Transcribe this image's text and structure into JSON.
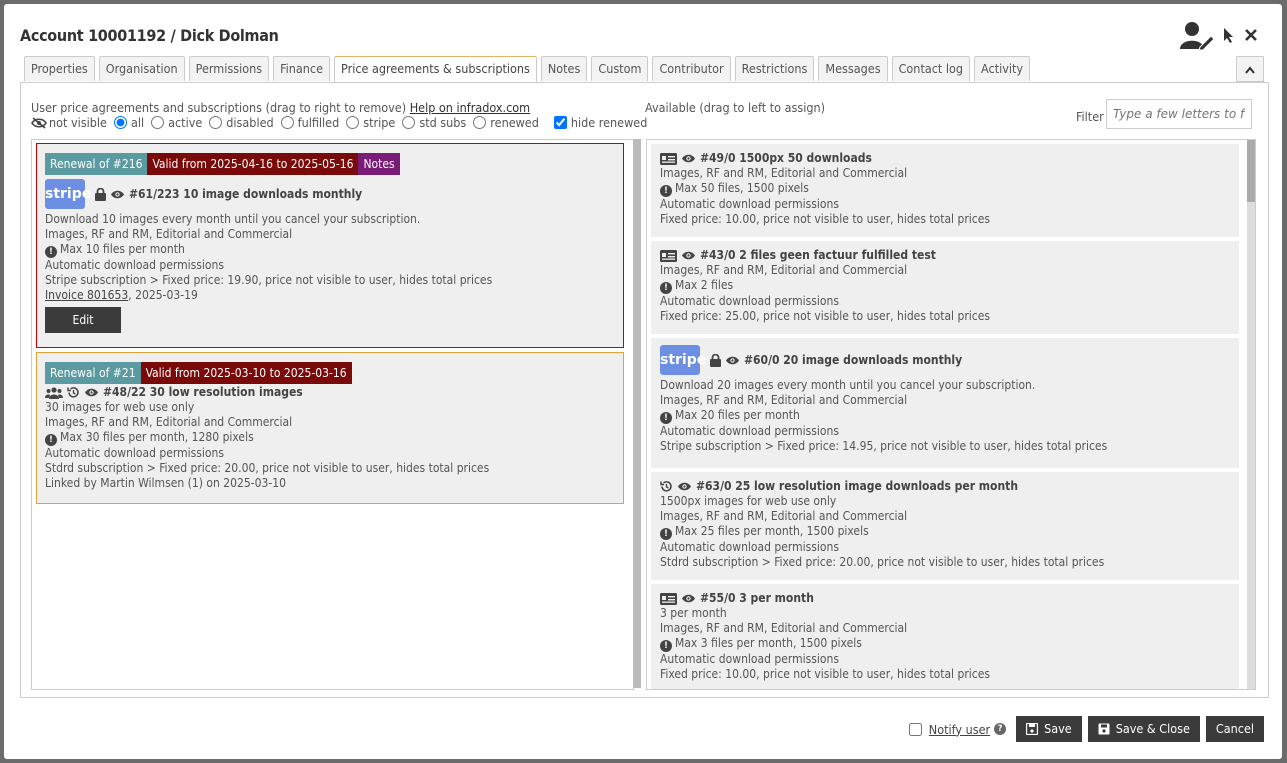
{
  "dialog": {
    "title": "Account 10001192 / Dick Dolman"
  },
  "tabs": [
    {
      "label": "Properties"
    },
    {
      "label": "Organisation"
    },
    {
      "label": "Permissions"
    },
    {
      "label": "Finance"
    },
    {
      "label": "Price agreements & subscriptions",
      "active": true
    },
    {
      "label": "Notes"
    },
    {
      "label": "Custom"
    },
    {
      "label": "Contributor"
    },
    {
      "label": "Restrictions"
    },
    {
      "label": "Messages"
    },
    {
      "label": "Contact log"
    },
    {
      "label": "Activity"
    }
  ],
  "left": {
    "heading": "User price agreements and subscriptions (drag to right to remove)",
    "help_link": "Help on infradox.com",
    "filters": {
      "not_visible": "not visible",
      "all": "all",
      "active": "active",
      "disabled": "disabled",
      "fulfilled": "fulfilled",
      "stripe": "stripe",
      "std_subs": "std subs",
      "renewed": "renewed",
      "hide_renewed": "hide renewed",
      "selected": "all",
      "hide_renewed_checked": true
    },
    "cards": [
      {
        "badges": [
          "Renewal of #216",
          "Valid from 2025-04-16 to 2025-05-16",
          "Notes"
        ],
        "logo": "stripe",
        "title": "#61/223 10 image downloads monthly",
        "lines": [
          "Download 10 images every month until you cancel your subscription.",
          "Images, RF and RM, Editorial and Commercial",
          "Max 10 files per month",
          "Automatic download permissions",
          "Stripe subscription > Fixed price: 19.90, price not visible to user, hides total prices"
        ],
        "invoice_link": "Invoice 801653",
        "invoice_date": ", 2025-03-19",
        "edit_label": "Edit"
      },
      {
        "badges": [
          "Renewal of #21",
          "Valid from 2025-03-10 to 2025-03-16"
        ],
        "title": "#48/22 30 low resolution images",
        "lines": [
          "30 images for web use only",
          "Images, RF and RM, Editorial and Commercial",
          "Max 30 files per month, 1280 pixels",
          "Automatic download permissions",
          "Stdrd subscription > Fixed price: 20.00, price not visible to user, hides total prices",
          "Linked by Martin Wilmsen (1) on 2025-03-10"
        ]
      }
    ]
  },
  "right": {
    "heading": "Available (drag to left to assign)",
    "filter_label": "Filter",
    "filter_placeholder": "Type a few letters to filter",
    "cards": [
      {
        "title": "#49/0 1500px 50 downloads",
        "lines": [
          "Images, RF and RM, Editorial and Commercial",
          "Max 50 files, 1500 pixels",
          "Automatic download permissions",
          "Fixed price: 10.00, price not visible to user, hides total prices"
        ]
      },
      {
        "title": "#43/0 2 files geen factuur fulfilled test",
        "lines": [
          "Images, RF and RM, Editorial and Commercial",
          "Max 2 files",
          "Automatic download permissions",
          "Fixed price: 25.00, price not visible to user, hides total prices"
        ]
      },
      {
        "logo": "stripe",
        "title": "#60/0 20 image downloads monthly",
        "lines": [
          "Download 20 images every month until you cancel your subscription.",
          "Images, RF and RM, Editorial and Commercial",
          "Max 20 files per month",
          "Automatic download permissions",
          "Stripe subscription > Fixed price: 14.95, price not visible to user, hides total prices"
        ]
      },
      {
        "title": "#63/0 25 low resolution image downloads per month",
        "lines": [
          "1500px images for web use only",
          "Images, RF and RM, Editorial and Commercial",
          "Max 25 files per month, 1500 pixels",
          "Automatic download permissions",
          "Stdrd subscription > Fixed price: 20.00, price not visible to user, hides total prices"
        ]
      },
      {
        "title": "#55/0 3 per month",
        "lines": [
          "3 per month",
          "Images, RF and RM, Editorial and Commercial",
          "Max 3 files per month, 1500 pixels",
          "Automatic download permissions",
          "Fixed price: 10.00, price not visible to user, hides total prices"
        ]
      }
    ]
  },
  "footer": {
    "notify_label": "Notify user",
    "save": "Save",
    "save_close": "Save & Close",
    "cancel": "Cancel"
  },
  "colors": {
    "renewal_badge": "#5b9aa0",
    "valid_badge": "#7a0a0a",
    "notes_badge": "#7a1b78",
    "stripe_logo": "#6d8fe3",
    "button_dark": "#3b3b3b",
    "selected_card_border": "#cc0000",
    "expired_card_border": "#e0a33b"
  }
}
